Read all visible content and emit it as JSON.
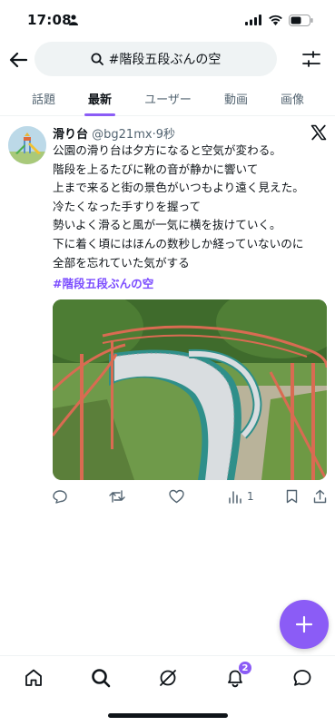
{
  "status_bar": {
    "time": "17:08"
  },
  "header": {
    "search_query": "#階段五段ぶんの空"
  },
  "tabs": [
    {
      "label": "話題"
    },
    {
      "label": "最新"
    },
    {
      "label": "ユーザー"
    },
    {
      "label": "動画"
    },
    {
      "label": "画像"
    }
  ],
  "active_tab": "最新",
  "post": {
    "author_name": "滑り台",
    "author_handle": "@bg21mx",
    "separator": "·",
    "time": "9秒",
    "lines": [
      "公園の滑り台は夕方になると空気が変わる。",
      "階段を上るたびに靴の音が静かに響いて",
      "上まで来ると街の景色がいつもより遠く見えた。",
      "冷たくなった手すりを握って",
      "勢いよく滑ると風が一気に横を抜けていく。",
      "下に着く頃にはほんの数秒しか経っていないのに",
      "全部を忘れていた気がする"
    ],
    "hashtag": "#階段五段ぶんの空",
    "view_count": "1"
  },
  "bottom_nav": {
    "notification_count": "2"
  },
  "colors": {
    "accent": "#8b5cf6",
    "hashtag": "#7c4dff",
    "muted": "#536471",
    "text": "#0f1419"
  },
  "icons": [
    "person-icon",
    "signal-icon",
    "wifi-icon",
    "battery-icon",
    "back-arrow-icon",
    "search-icon",
    "filter-sliders-icon",
    "x-logo-icon",
    "reply-icon",
    "retweet-icon",
    "like-icon",
    "views-icon",
    "bookmark-icon",
    "share-icon",
    "plus-icon",
    "home-icon",
    "search-nav-icon",
    "grok-icon",
    "bell-icon",
    "messages-icon"
  ]
}
